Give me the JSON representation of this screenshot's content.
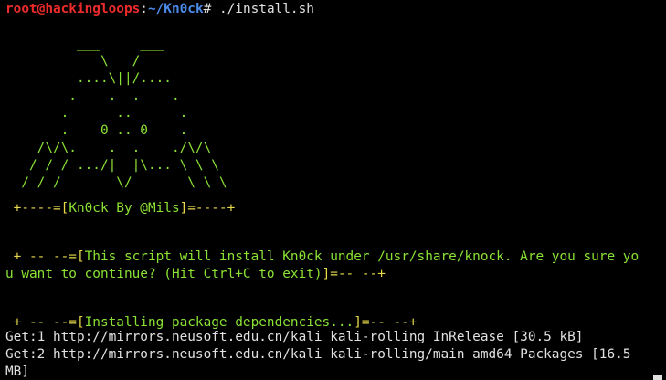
{
  "prompt": {
    "user_host": "root@hackingloops",
    "separator": ":",
    "path": "~/Kn0ck",
    "symbol": "#",
    "command": " ./install.sh"
  },
  "ascii_art": [
    "         ___     ___",
    "            \\   /",
    "         ....\\||/....",
    "        .    .  .    .",
    "       .      ..      .",
    "       .    0 .. 0    .",
    "    /\\/\\.    .  .    ./\\/\\",
    "   / / / .../|  |\\... \\ \\ \\",
    "  / / /       \\/       \\ \\ \\"
  ],
  "banner": {
    "prefix": " +----=[",
    "text": "Kn0ck By @Mils",
    "suffix": "]=----+"
  },
  "confirm": {
    "prefix": " + -- --=[",
    "line1_text": "This script will install Kn0ck under /usr/share/knock. Are you sure yo",
    "line2_text": "u want to continue? (Hit Ctrl+C to exit)",
    "suffix": "]=-- --+"
  },
  "installing": {
    "prefix": " + -- --=[",
    "text": "Installing package dependencies...",
    "suffix": "]=-- --+"
  },
  "apt_output": [
    "Get:1 http://mirrors.neusoft.edu.cn/kali kali-rolling InRelease [30.5 kB]",
    "Get:2 http://mirrors.neusoft.edu.cn/kali kali-rolling/main amd64 Packages [16.5",
    "MB]"
  ],
  "colors": {
    "background": "#000000",
    "user_host": "#ee2b2b",
    "path": "#4d8bea",
    "text": "#e0e0e0",
    "green": "#8ae234",
    "yellow": "#e7d94a"
  }
}
